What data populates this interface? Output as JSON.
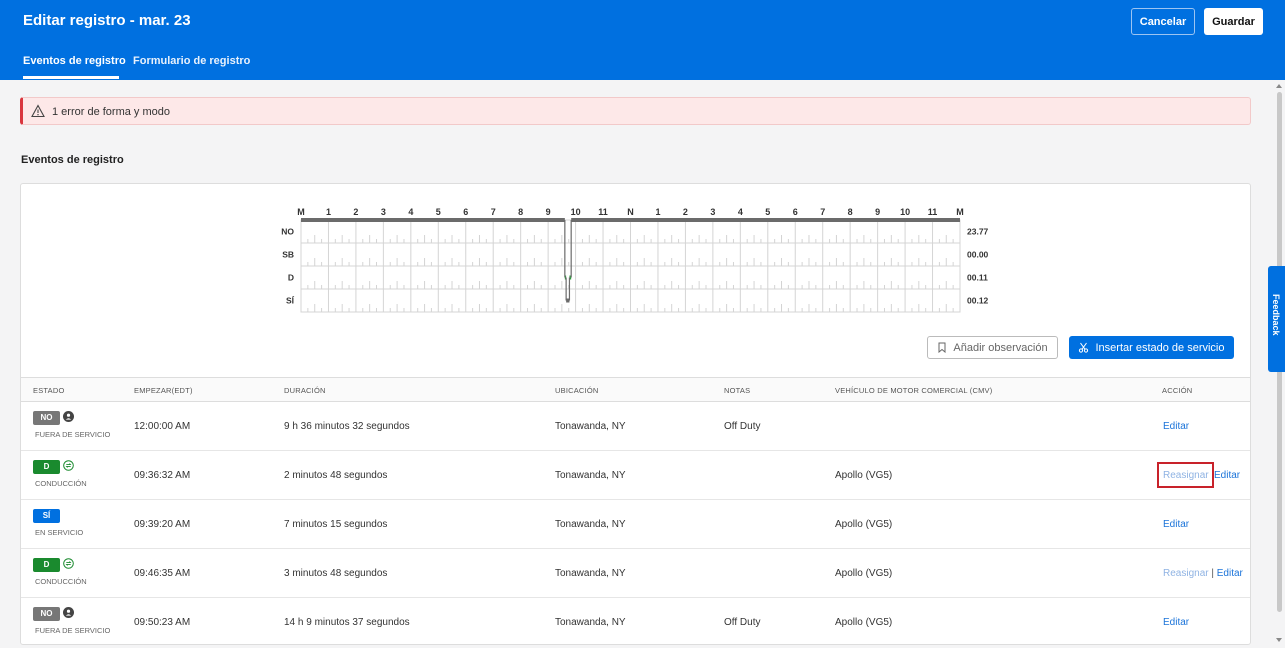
{
  "header": {
    "title": "Editar registro - mar. 23",
    "cancel_label": "Cancelar",
    "save_label": "Guardar",
    "tabs": [
      {
        "label": "Eventos de registro",
        "active": true
      },
      {
        "label": "Formulario de registro",
        "active": false
      }
    ]
  },
  "alert": {
    "message": "1 error de forma y modo"
  },
  "section": {
    "title": "Eventos de registro"
  },
  "graph": {
    "hours": [
      "M",
      "1",
      "2",
      "3",
      "4",
      "5",
      "6",
      "7",
      "8",
      "9",
      "10",
      "11",
      "N",
      "1",
      "2",
      "3",
      "4",
      "5",
      "6",
      "7",
      "8",
      "9",
      "10",
      "11",
      "M"
    ],
    "rows": [
      {
        "label": "NO",
        "total": "23.77"
      },
      {
        "label": "SB",
        "total": "00.00"
      },
      {
        "label": "D",
        "total": "00.11"
      },
      {
        "label": "SÍ",
        "total": "00.12"
      }
    ],
    "colors": {
      "line": "#6b6b6b",
      "drive": "#2e9e3f",
      "grid": "#d4d4d4"
    }
  },
  "actions": {
    "add_note_label": "Añadir observación",
    "insert_label": "Insertar estado de servicio"
  },
  "table": {
    "headers": [
      "ESTADO",
      "EMPEZAR(EDT)",
      "DURACIÓN",
      "UBICACIÓN",
      "NOTAS",
      "VEHÍCULO DE MOTOR COMERCIAL (CMV)",
      "ACCIÓN"
    ],
    "rows": [
      {
        "badge": "NO",
        "type": "no",
        "icon": "person-icon",
        "status": "FUERA DE SERVICIO",
        "start": "12:00:00 AM",
        "duration": "9 h 36 minutos 32 segundos",
        "location": "Tonawanda, NY",
        "notes": "Off Duty",
        "vehicle": "",
        "reassign": "",
        "edit": "Editar"
      },
      {
        "badge": "D",
        "type": "d",
        "icon": "sync-icon",
        "status": "CONDUCCIÓN",
        "start": "09:36:32 AM",
        "duration": "2 minutos 48 segundos",
        "location": "Tonawanda, NY",
        "notes": "",
        "vehicle": "Apollo (VG5)",
        "reassign": "Reasignar",
        "edit": "Editar"
      },
      {
        "badge": "SÍ",
        "type": "si",
        "icon": "",
        "status": "EN SERVICIO",
        "start": "09:39:20 AM",
        "duration": "7 minutos 15 segundos",
        "location": "Tonawanda, NY",
        "notes": "",
        "vehicle": "Apollo (VG5)",
        "reassign": "",
        "edit": "Editar"
      },
      {
        "badge": "D",
        "type": "d",
        "icon": "sync-icon",
        "status": "CONDUCCIÓN",
        "start": "09:46:35 AM",
        "duration": "3 minutos 48 segundos",
        "location": "Tonawanda, NY",
        "notes": "",
        "vehicle": "Apollo (VG5)",
        "reassign": "Reasignar",
        "edit": "Editar"
      },
      {
        "badge": "NO",
        "type": "no",
        "icon": "person-icon",
        "status": "FUERA DE SERVICIO",
        "start": "09:50:23 AM",
        "duration": "14 h 9 minutos 37 segundos",
        "location": "Tonawanda, NY",
        "notes": "Off Duty",
        "vehicle": "Apollo (VG5)",
        "reassign": "",
        "edit": "Editar"
      }
    ]
  },
  "feedback": {
    "label": "Feedback"
  }
}
